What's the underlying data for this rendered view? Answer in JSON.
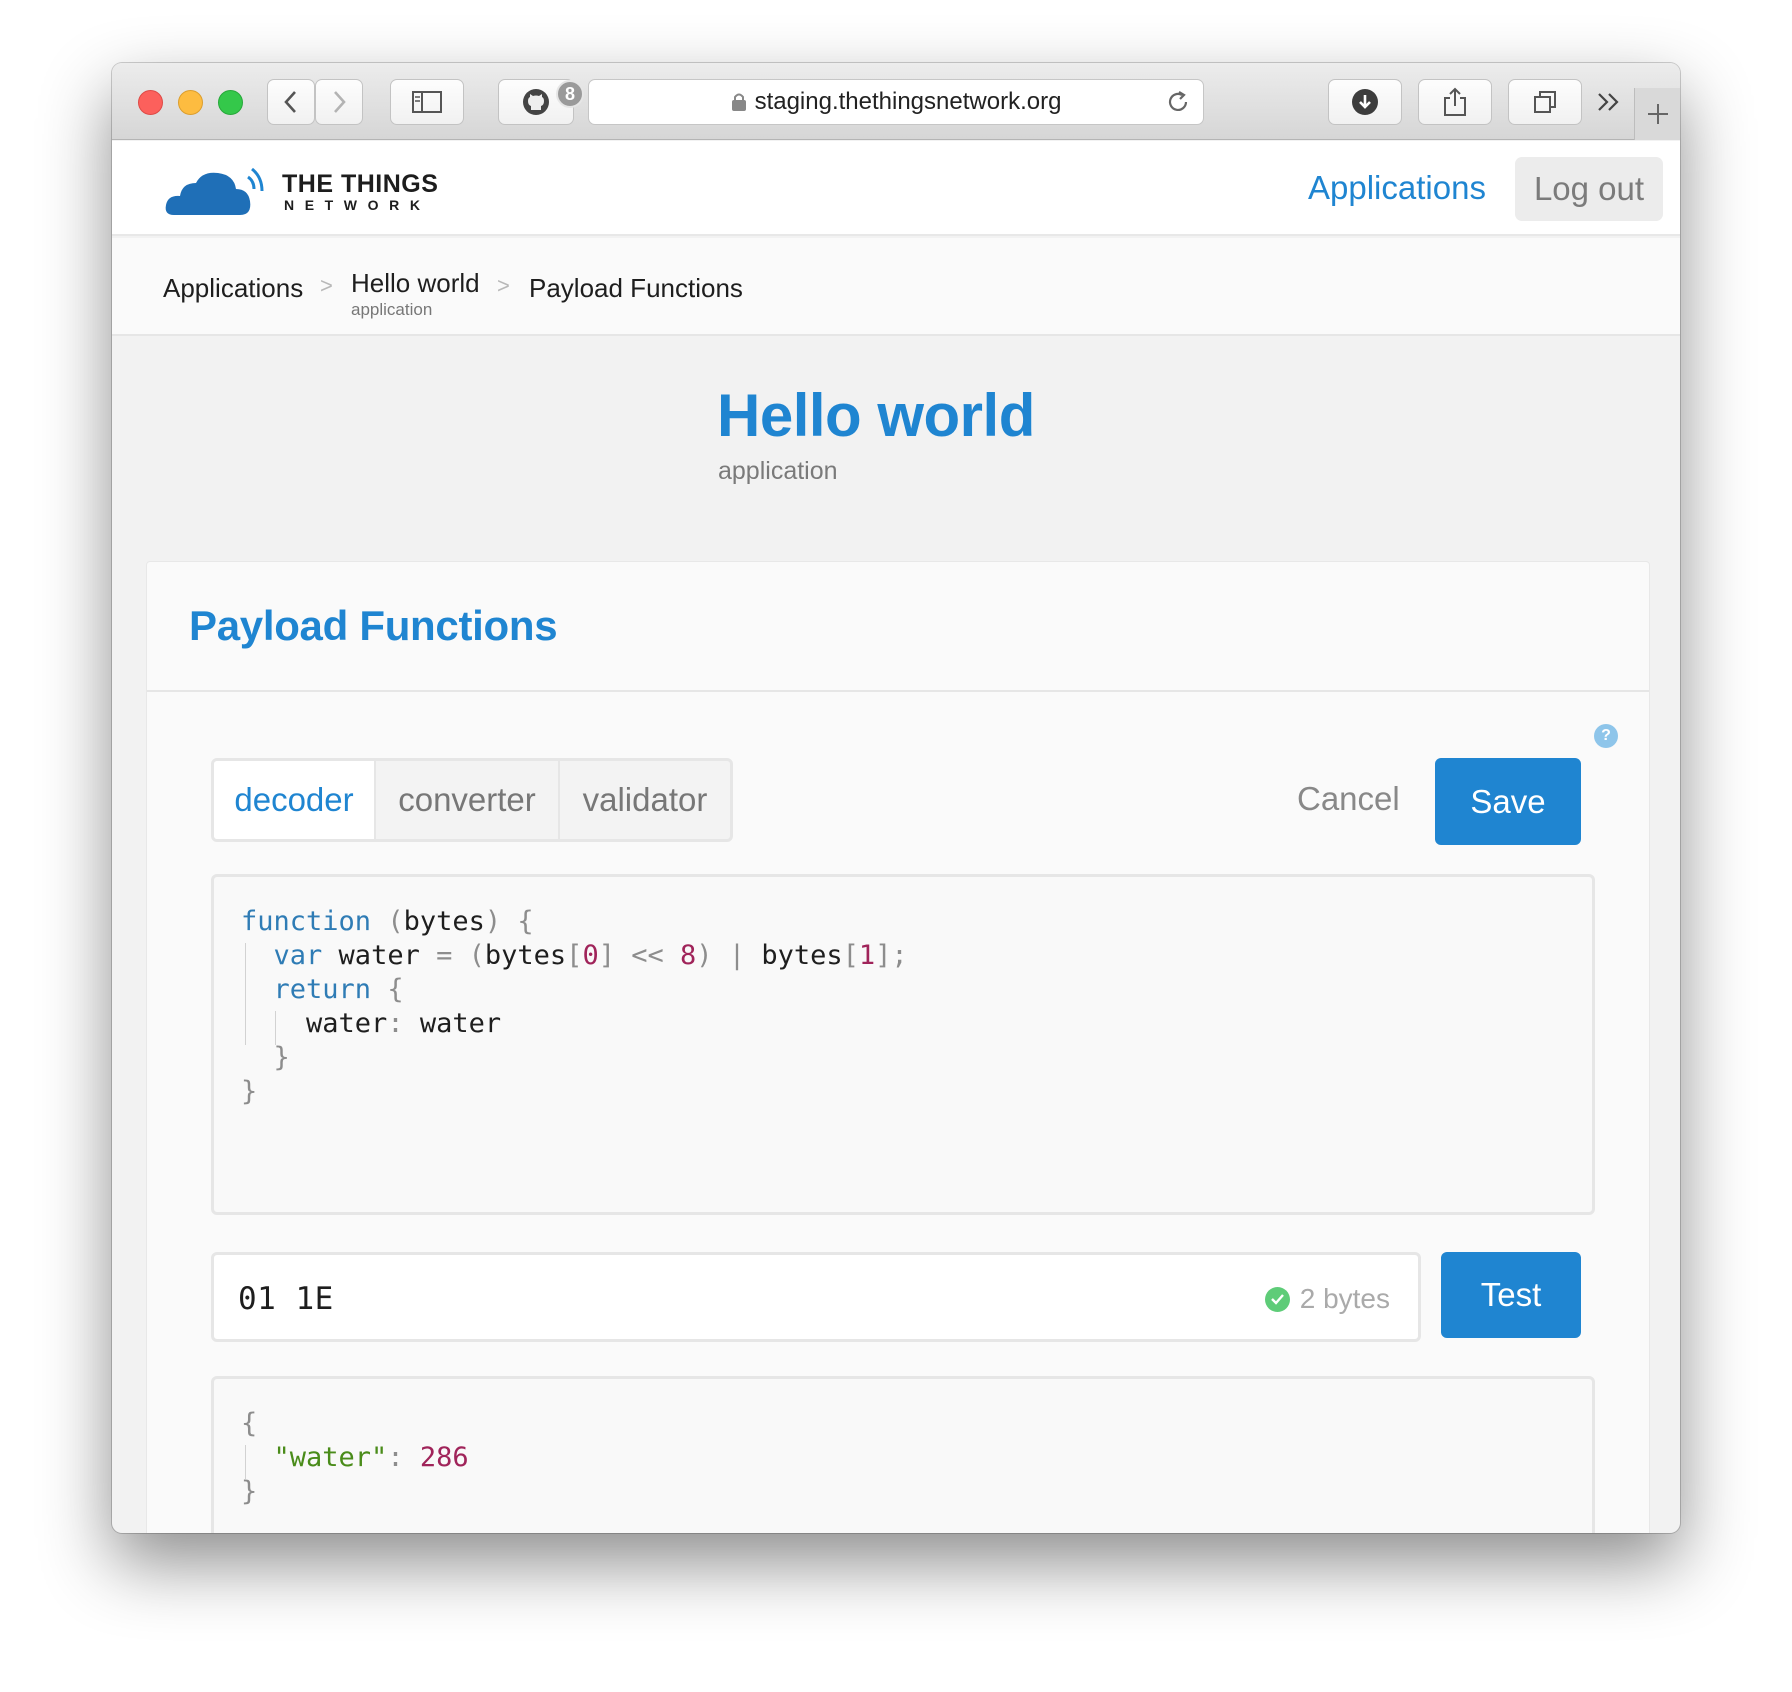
{
  "browser": {
    "url": "staging.thethingsnetwork.org",
    "github_badge": "8"
  },
  "header": {
    "logo_line1": "THE THINGS",
    "logo_line2": "NETWORK",
    "nav_applications": "Applications",
    "logout_label": "Log out",
    "brand_color": "#1f85d1"
  },
  "breadcrumb": {
    "items": [
      {
        "label": "Applications"
      },
      {
        "label": "Hello world",
        "sub": "application"
      },
      {
        "label": "Payload Functions"
      }
    ],
    "separator": ">"
  },
  "page": {
    "title": "Hello world",
    "subtitle": "application"
  },
  "card": {
    "title": "Payload Functions",
    "help_glyph": "?",
    "tabs": [
      {
        "label": "decoder",
        "active": true
      },
      {
        "label": "converter",
        "active": false
      },
      {
        "label": "validator",
        "active": false
      }
    ],
    "cancel_label": "Cancel",
    "save_label": "Save",
    "code_lines": [
      "function (bytes) {",
      "  var water = (bytes[0] << 8) | bytes[1];",
      "  return {",
      "    water: water",
      "  }",
      "}"
    ],
    "payload_value": "01 1E",
    "payload_size": "2 bytes",
    "test_label": "Test",
    "result_lines": [
      "{",
      "  \"water\": 286",
      "}"
    ]
  }
}
